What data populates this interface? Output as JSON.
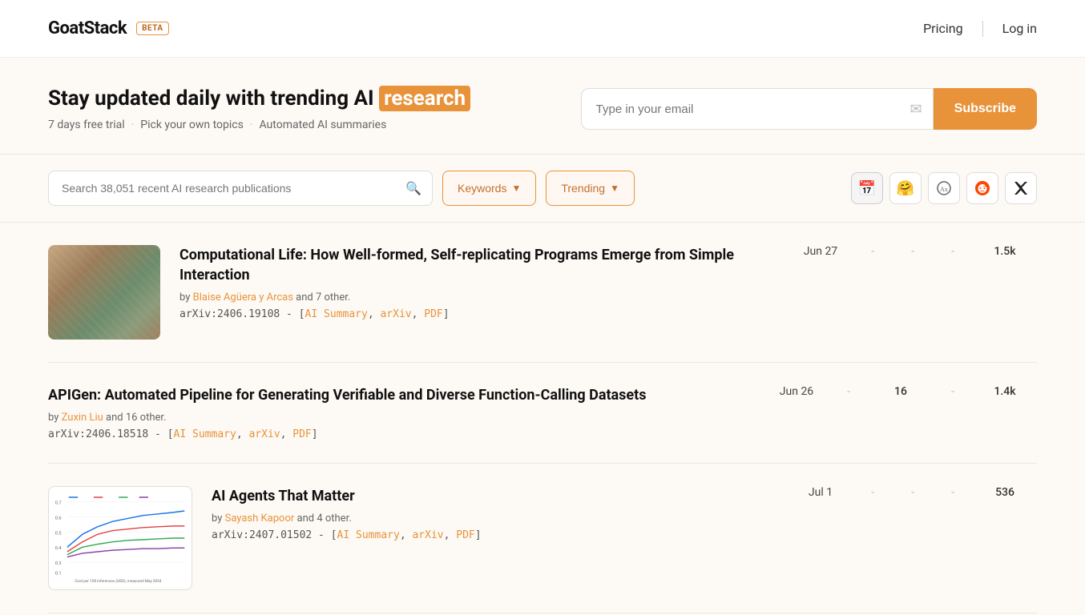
{
  "brand": {
    "name": "GoatStack",
    "beta": "BETA"
  },
  "nav": {
    "pricing": "Pricing",
    "login": "Log in"
  },
  "hero": {
    "title_prefix": "Stay updated daily with trending AI ",
    "title_highlight": "research",
    "trial": "7 days free trial",
    "dot": "·",
    "topics": "Pick your own topics",
    "summaries": "Automated AI summaries",
    "email_placeholder": "Type in your email",
    "subscribe_btn": "Subscribe"
  },
  "search": {
    "placeholder": "Search 38,051 recent AI research publications"
  },
  "filters": {
    "keywords_label": "Keywords",
    "trending_label": "Trending"
  },
  "papers": [
    {
      "id": "paper1",
      "thumbnail": "noise",
      "title": "Computational Life: How Well-formed, Self-replicating Programs Emerge from Simple Interaction",
      "authors_prefix": "by ",
      "author_link": "Blaise Agüera y Arcas",
      "authors_suffix": " and 7 other.",
      "arxiv_id": "arXiv:2406.19108",
      "links": [
        "AI Summary",
        "arXiv",
        "PDF"
      ],
      "date": "Jun 27",
      "stat1": "-",
      "stat2": "-",
      "stat3": "-",
      "count": "1.5k"
    },
    {
      "id": "paper2",
      "thumbnail": "none",
      "title": "APIGen: Automated Pipeline for Generating Verifiable and Diverse Function-Calling Datasets",
      "authors_prefix": "by ",
      "author_link": "Zuxin Liu",
      "authors_suffix": " and 16 other.",
      "arxiv_id": "arXiv:2406.18518",
      "links": [
        "AI Summary",
        "arXiv",
        "PDF"
      ],
      "date": "Jun 26",
      "stat1": "-",
      "stat2": "16",
      "stat3": "-",
      "count": "1.4k"
    },
    {
      "id": "paper3",
      "thumbnail": "chart",
      "title": "AI Agents That Matter",
      "authors_prefix": "by ",
      "author_link": "Sayash Kapoor",
      "authors_suffix": " and 4 other.",
      "arxiv_id": "arXiv:2407.01502",
      "links": [
        "AI Summary",
        "arXiv",
        "PDF"
      ],
      "date": "Jul 1",
      "stat1": "-",
      "stat2": "-",
      "stat3": "-",
      "count": "536"
    }
  ],
  "colors": {
    "accent": "#e8923a",
    "brand_text": "#111"
  }
}
